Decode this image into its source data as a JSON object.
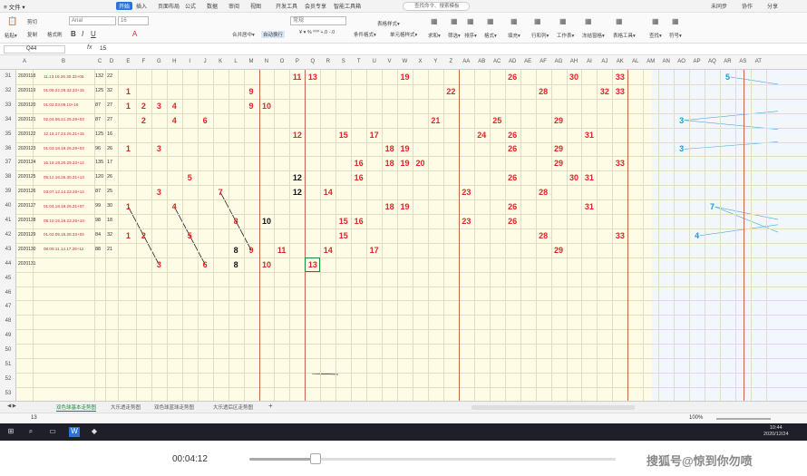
{
  "menubar": {
    "file": "≡ 文件 ▾",
    "tabs": [
      "开始",
      "插入",
      "页面布局",
      "公式",
      "数据",
      "审阅",
      "视图",
      "开发工具",
      "会员专享",
      "智能工具箱"
    ],
    "active_tab": "开始",
    "search": "查找命令、搜索模板",
    "right": [
      "未同步",
      "协作",
      "分享"
    ]
  },
  "ribbon": {
    "clip": [
      "粘贴▾",
      "剪切",
      "复制",
      "格式刷"
    ],
    "font_name": "Arial",
    "font_size": "16",
    "align": [
      "合并居中▾",
      "自动换行"
    ],
    "number_format": "常规",
    "styles": [
      "表格样式▾",
      "条件格式▾",
      "单元格样式▾"
    ],
    "right": [
      "求和▾",
      "筛选▾",
      "排序▾",
      "格式▾",
      "填充▾",
      "行和列▾",
      "工作表▾",
      "冻结窗格▾",
      "表格工具▾",
      "查找▾",
      "符号▾"
    ]
  },
  "formula": {
    "cell": "Q44",
    "fx": "fx",
    "value": "15"
  },
  "columns": [
    "A",
    "B",
    "C",
    "D",
    "E",
    "F",
    "G",
    "H",
    "I",
    "J",
    "K",
    "L",
    "M",
    "N",
    "O",
    "P",
    "Q",
    "R",
    "S",
    "T",
    "U",
    "V",
    "W",
    "X",
    "Y",
    "Z",
    "AA",
    "AB",
    "AC",
    "AD",
    "AE",
    "AF",
    "AG",
    "AH",
    "AI",
    "AJ",
    "AK",
    "AL",
    "AM",
    "AN",
    "AO",
    "AP",
    "AQ",
    "AR",
    "AS",
    "AT"
  ],
  "row_numbers": [
    "31",
    "32",
    "33",
    "34",
    "35",
    "36",
    "37",
    "38",
    "39",
    "40",
    "41",
    "42",
    "43",
    "44",
    "45",
    "46",
    "47",
    "48",
    "49",
    "50",
    "51",
    "52",
    "53"
  ],
  "rows": [
    {
      "date": "2020118",
      "seq": "11.13.16.26.30.33+05",
      "c": "132",
      "d": "22"
    },
    {
      "date": "2020119",
      "seq": "01.09.22.28.32.33+15",
      "c": "125",
      "d": "32"
    },
    {
      "date": "2020120",
      "seq": "01.02.03.09.10+16",
      "c": "87",
      "d": "27"
    },
    {
      "date": "2020121",
      "seq": "02.04.06.21.25.29+03",
      "c": "87",
      "d": "27"
    },
    {
      "date": "2020122",
      "seq": "12.15.17.24.26.31+15",
      "c": "125",
      "d": "16"
    },
    {
      "date": "2020123",
      "seq": "01.03.18.19.26.29+03",
      "c": "96",
      "d": "26"
    },
    {
      "date": "2020124",
      "seq": "16.18.19.20.29.33+12",
      "c": "135",
      "d": "17"
    },
    {
      "date": "2020125",
      "seq": "05.12.16.26.30.31+13",
      "c": "120",
      "d": "26"
    },
    {
      "date": "2020126",
      "seq": "03.07.12.14.23.28+14",
      "c": "87",
      "d": "25"
    },
    {
      "date": "2020127",
      "seq": "01.04.18.19.26.31+07",
      "c": "99",
      "d": "30"
    },
    {
      "date": "2020128",
      "seq": "08.10.15.16.23.26+10",
      "c": "98",
      "d": "18"
    },
    {
      "date": "2020129",
      "seq": "01.02.05.15.28.33+04",
      "c": "84",
      "d": "32"
    },
    {
      "date": "2020130",
      "seq": "08.09.11.14.17.29+12",
      "c": "88",
      "d": "21"
    },
    {
      "date": "2020131",
      "seq": "",
      "c": "",
      "d": ""
    }
  ],
  "numbers": [
    {
      "r": 0,
      "col": 15,
      "v": "11",
      "c": "red"
    },
    {
      "r": 0,
      "col": 16,
      "v": "13",
      "c": "red"
    },
    {
      "r": 0,
      "col": 22,
      "v": "19",
      "c": "red"
    },
    {
      "r": 0,
      "col": 29,
      "v": "26",
      "c": "red"
    },
    {
      "r": 0,
      "col": 33,
      "v": "30",
      "c": "red"
    },
    {
      "r": 0,
      "col": 36,
      "v": "33",
      "c": "red"
    },
    {
      "r": 0,
      "col": 43,
      "v": "5",
      "c": "blu"
    },
    {
      "r": 1,
      "col": 4,
      "v": "1",
      "c": "red"
    },
    {
      "r": 1,
      "col": 12,
      "v": "9",
      "c": "red"
    },
    {
      "r": 1,
      "col": 25,
      "v": "22",
      "c": "red"
    },
    {
      "r": 1,
      "col": 31,
      "v": "28",
      "c": "red"
    },
    {
      "r": 1,
      "col": 35,
      "v": "32",
      "c": "red"
    },
    {
      "r": 1,
      "col": 36,
      "v": "33",
      "c": "red"
    },
    {
      "r": 2,
      "col": 4,
      "v": "1",
      "c": "red"
    },
    {
      "r": 2,
      "col": 5,
      "v": "2",
      "c": "red"
    },
    {
      "r": 2,
      "col": 6,
      "v": "3",
      "c": "red"
    },
    {
      "r": 2,
      "col": 7,
      "v": "4",
      "c": "red"
    },
    {
      "r": 2,
      "col": 12,
      "v": "9",
      "c": "red"
    },
    {
      "r": 2,
      "col": 13,
      "v": "10",
      "c": "red"
    },
    {
      "r": 3,
      "col": 5,
      "v": "2",
      "c": "red"
    },
    {
      "r": 3,
      "col": 7,
      "v": "4",
      "c": "red"
    },
    {
      "r": 3,
      "col": 9,
      "v": "6",
      "c": "red"
    },
    {
      "r": 3,
      "col": 24,
      "v": "21",
      "c": "red"
    },
    {
      "r": 3,
      "col": 28,
      "v": "25",
      "c": "red"
    },
    {
      "r": 3,
      "col": 32,
      "v": "29",
      "c": "red"
    },
    {
      "r": 3,
      "col": 40,
      "v": "3",
      "c": "blu"
    },
    {
      "r": 4,
      "col": 15,
      "v": "12",
      "c": "red"
    },
    {
      "r": 4,
      "col": 18,
      "v": "15",
      "c": "red"
    },
    {
      "r": 4,
      "col": 20,
      "v": "17",
      "c": "red"
    },
    {
      "r": 4,
      "col": 27,
      "v": "24",
      "c": "red"
    },
    {
      "r": 4,
      "col": 29,
      "v": "26",
      "c": "red"
    },
    {
      "r": 4,
      "col": 34,
      "v": "31",
      "c": "red"
    },
    {
      "r": 5,
      "col": 4,
      "v": "1",
      "c": "red"
    },
    {
      "r": 5,
      "col": 6,
      "v": "3",
      "c": "red"
    },
    {
      "r": 5,
      "col": 21,
      "v": "18",
      "c": "red"
    },
    {
      "r": 5,
      "col": 22,
      "v": "19",
      "c": "red"
    },
    {
      "r": 5,
      "col": 29,
      "v": "26",
      "c": "red"
    },
    {
      "r": 5,
      "col": 32,
      "v": "29",
      "c": "red"
    },
    {
      "r": 5,
      "col": 40,
      "v": "3",
      "c": "blu"
    },
    {
      "r": 6,
      "col": 19,
      "v": "16",
      "c": "red"
    },
    {
      "r": 6,
      "col": 21,
      "v": "18",
      "c": "red"
    },
    {
      "r": 6,
      "col": 22,
      "v": "19",
      "c": "red"
    },
    {
      "r": 6,
      "col": 23,
      "v": "20",
      "c": "red"
    },
    {
      "r": 6,
      "col": 32,
      "v": "29",
      "c": "red"
    },
    {
      "r": 6,
      "col": 36,
      "v": "33",
      "c": "red"
    },
    {
      "r": 7,
      "col": 8,
      "v": "5",
      "c": "red"
    },
    {
      "r": 7,
      "col": 15,
      "v": "12",
      "c": "blk"
    },
    {
      "r": 7,
      "col": 19,
      "v": "16",
      "c": "red"
    },
    {
      "r": 7,
      "col": 29,
      "v": "26",
      "c": "red"
    },
    {
      "r": 7,
      "col": 33,
      "v": "30",
      "c": "red"
    },
    {
      "r": 7,
      "col": 34,
      "v": "31",
      "c": "red"
    },
    {
      "r": 8,
      "col": 6,
      "v": "3",
      "c": "red"
    },
    {
      "r": 8,
      "col": 10,
      "v": "7",
      "c": "red"
    },
    {
      "r": 8,
      "col": 15,
      "v": "12",
      "c": "blk"
    },
    {
      "r": 8,
      "col": 17,
      "v": "14",
      "c": "red"
    },
    {
      "r": 8,
      "col": 26,
      "v": "23",
      "c": "red"
    },
    {
      "r": 8,
      "col": 31,
      "v": "28",
      "c": "red"
    },
    {
      "r": 9,
      "col": 4,
      "v": "1",
      "c": "red"
    },
    {
      "r": 9,
      "col": 7,
      "v": "4",
      "c": "red"
    },
    {
      "r": 9,
      "col": 21,
      "v": "18",
      "c": "red"
    },
    {
      "r": 9,
      "col": 22,
      "v": "19",
      "c": "red"
    },
    {
      "r": 9,
      "col": 29,
      "v": "26",
      "c": "red"
    },
    {
      "r": 9,
      "col": 34,
      "v": "31",
      "c": "red"
    },
    {
      "r": 9,
      "col": 42,
      "v": "7",
      "c": "blu"
    },
    {
      "r": 10,
      "col": 11,
      "v": "8",
      "c": "red"
    },
    {
      "r": 10,
      "col": 13,
      "v": "10",
      "c": "blk"
    },
    {
      "r": 10,
      "col": 18,
      "v": "15",
      "c": "red"
    },
    {
      "r": 10,
      "col": 19,
      "v": "16",
      "c": "red"
    },
    {
      "r": 10,
      "col": 26,
      "v": "23",
      "c": "red"
    },
    {
      "r": 10,
      "col": 29,
      "v": "26",
      "c": "red"
    },
    {
      "r": 11,
      "col": 4,
      "v": "1",
      "c": "red"
    },
    {
      "r": 11,
      "col": 5,
      "v": "2",
      "c": "red"
    },
    {
      "r": 11,
      "col": 8,
      "v": "5",
      "c": "red"
    },
    {
      "r": 11,
      "col": 18,
      "v": "15",
      "c": "red"
    },
    {
      "r": 11,
      "col": 31,
      "v": "28",
      "c": "red"
    },
    {
      "r": 11,
      "col": 36,
      "v": "33",
      "c": "red"
    },
    {
      "r": 11,
      "col": 41,
      "v": "4",
      "c": "blu"
    },
    {
      "r": 12,
      "col": 11,
      "v": "8",
      "c": "blk"
    },
    {
      "r": 12,
      "col": 12,
      "v": "9",
      "c": "red"
    },
    {
      "r": 12,
      "col": 14,
      "v": "11",
      "c": "red"
    },
    {
      "r": 12,
      "col": 17,
      "v": "14",
      "c": "red"
    },
    {
      "r": 12,
      "col": 20,
      "v": "17",
      "c": "red"
    },
    {
      "r": 12,
      "col": 32,
      "v": "29",
      "c": "red"
    },
    {
      "r": 13,
      "col": 6,
      "v": "3",
      "c": "red"
    },
    {
      "r": 13,
      "col": 9,
      "v": "6",
      "c": "red"
    },
    {
      "r": 13,
      "col": 11,
      "v": "8",
      "c": "blk"
    },
    {
      "r": 13,
      "col": 13,
      "v": "10",
      "c": "red"
    },
    {
      "r": 13,
      "col": 16,
      "v": "13",
      "c": "red"
    }
  ],
  "sheets": [
    "双色球基本走势图",
    "大乐透走势图",
    "双色球蓝球走势图",
    "大乐透后区走势图"
  ],
  "active_sheet": "双色球基本走势图",
  "status": {
    "left": "13",
    "zoom": "100%"
  },
  "clock": {
    "time": "10:44",
    "date": "2020/12/24"
  },
  "player": {
    "time": "00:04:12",
    "progress": 0.18
  },
  "watermark": "搜狐号@惊到你勿喷",
  "colors": {
    "accent": "#2b73d9",
    "red": "#e02525",
    "blue": "#1a9ad6",
    "selection": "#1e8a3c"
  }
}
